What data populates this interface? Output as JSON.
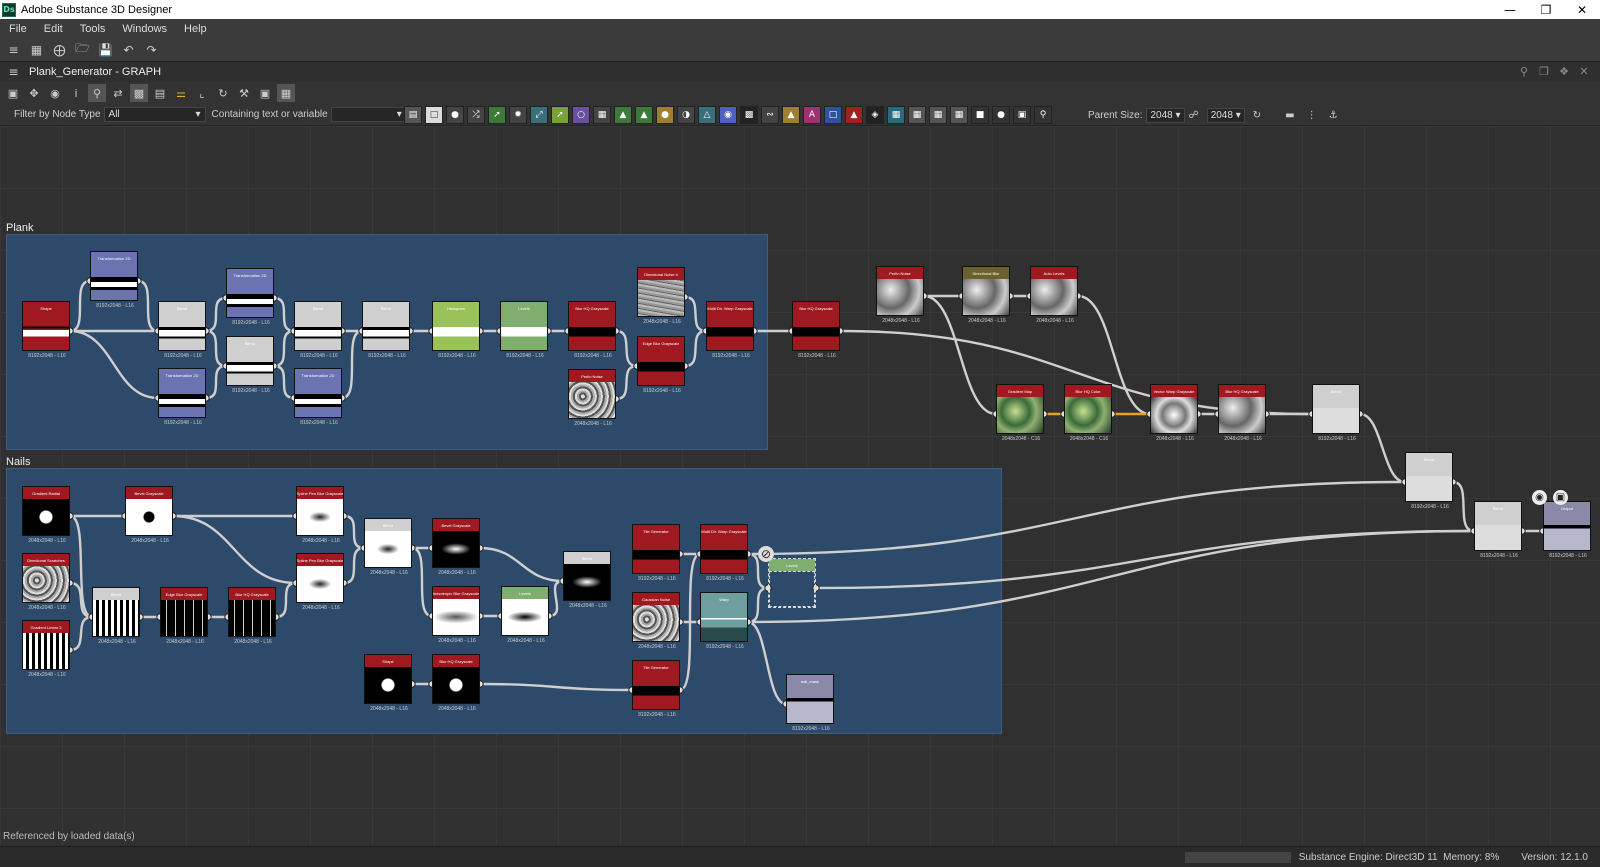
{
  "window": {
    "title": "Adobe Substance 3D Designer",
    "logo": "Ds"
  },
  "menu": [
    "File",
    "Edit",
    "Tools",
    "Windows",
    "Help"
  ],
  "graph": {
    "title": "Plank_Generator - GRAPH"
  },
  "filter": {
    "label_type": "Filter by Node Type",
    "type_value": "All",
    "label_text": "Containing text or variable",
    "text_value": ""
  },
  "parent_size": {
    "label": "Parent Size:",
    "width": "2048",
    "height": "2048"
  },
  "frames": {
    "plank": "Plank",
    "nails": "Nails"
  },
  "nodes": [
    {
      "id": "p1",
      "title": "Shape",
      "res": "8192x2048 - L16",
      "head": "#a01820",
      "body": "white-bar-red"
    },
    {
      "id": "p2",
      "title": "Transformation 2D",
      "res": "8192x2048 - L16",
      "head": "#6b73b0",
      "body": "bar-blue"
    },
    {
      "id": "p3",
      "title": "Blend",
      "res": "8192x2048 - L16",
      "head": "#cfcfcf",
      "body": "bar-gray"
    },
    {
      "id": "p4",
      "title": "Transformation 2D",
      "res": "8192x2048 - L16",
      "head": "#6b73b0",
      "body": "bar-blue"
    },
    {
      "id": "p5",
      "title": "Transformation 2D",
      "res": "8192x2048 - L16",
      "head": "#6b73b0",
      "body": "bar-blue"
    },
    {
      "id": "p6",
      "title": "Blend",
      "res": "8192x2048 - L16",
      "head": "#cfcfcf",
      "body": "bar-gray"
    },
    {
      "id": "p7",
      "title": "Blend",
      "res": "8192x2048 - L16",
      "head": "#cfcfcf",
      "body": "bar-gray"
    },
    {
      "id": "p8",
      "title": "Transformation 2D",
      "res": "8192x2048 - L16",
      "head": "#6b73b0",
      "body": "bar-blue"
    },
    {
      "id": "p9",
      "title": "Blend",
      "res": "8192x2048 - L16",
      "head": "#cfcfcf",
      "body": "bar-gray"
    },
    {
      "id": "p10",
      "title": "Histogram",
      "res": "8192x2048 - L16",
      "head": "#9ac25a",
      "body": "bar-green"
    },
    {
      "id": "p11",
      "title": "Levels",
      "res": "8192x2048 - L16",
      "head": "#7fae6e",
      "body": "bar-green2"
    },
    {
      "id": "p12",
      "title": "Blur HQ Grayscale",
      "res": "8192x2048 - L16",
      "head": "#a01820",
      "body": "red"
    },
    {
      "id": "p13",
      "title": "Perlin Noise",
      "res": "2048x2048 - L16",
      "head": "#a01820",
      "body": "noise"
    },
    {
      "id": "p14",
      "title": "Directional Noise 4",
      "res": "2048x2048 - L16",
      "head": "#a01820",
      "body": "noise2"
    },
    {
      "id": "p15",
      "title": "Edge Blur Grayscale",
      "res": "8192x2048 - L16",
      "head": "#a01820",
      "body": "red"
    },
    {
      "id": "p16",
      "title": "Multi Dir. Warp Grayscale",
      "res": "8192x2048 - L16",
      "head": "#a01820",
      "body": "red"
    },
    {
      "id": "p17",
      "title": "Blur HQ Grayscale",
      "res": "8192x2048 - L16",
      "head": "#a01820",
      "body": "red"
    },
    {
      "id": "w1",
      "title": "Perlin Noise",
      "res": "2048x2048 - L16",
      "head": "#a01820",
      "body": "blur"
    },
    {
      "id": "w2",
      "title": "Directional Blur",
      "res": "2048x2048 - L16",
      "head": "#6a6030",
      "body": "blur"
    },
    {
      "id": "w3",
      "title": "Auto Levels",
      "res": "2048x2048 - L16",
      "head": "#a01820",
      "body": "blur"
    },
    {
      "id": "w4",
      "title": "Gradient Map",
      "res": "2048x2048 - C16",
      "head": "#a01820",
      "body": "color"
    },
    {
      "id": "w5",
      "title": "Blur HQ Color",
      "res": "2048x2048 - C16",
      "head": "#a01820",
      "body": "color"
    },
    {
      "id": "w6",
      "title": "Vector Warp Grayscale",
      "res": "2048x2048 - L16",
      "head": "#a01820",
      "body": "warp"
    },
    {
      "id": "w7",
      "title": "Blur HQ Grayscale",
      "res": "2048x2048 - L16",
      "head": "#a01820",
      "body": "blur"
    },
    {
      "id": "w8",
      "title": "Blend",
      "res": "8192x2048 - L16",
      "head": "#cfcfcf",
      "body": "gray"
    },
    {
      "id": "w9",
      "title": "Blend",
      "res": "8192x2048 - L16",
      "head": "#cfcfcf",
      "body": "gray"
    },
    {
      "id": "w10",
      "title": "Blend",
      "res": "8192x2048 - L16",
      "head": "#cfcfcf",
      "body": "gray"
    },
    {
      "id": "w11",
      "title": "Output",
      "res": "8192x2048 - L16",
      "head": "#8a8aa8",
      "body": "out"
    },
    {
      "id": "n1",
      "title": "Gradient Radial",
      "res": "2048x2048 - L16",
      "head": "#a01820",
      "body": "dot-black"
    },
    {
      "id": "n2",
      "title": "Bevel Grayscale",
      "res": "2048x2048 - L16",
      "head": "#a01820",
      "body": "dot-white"
    },
    {
      "id": "n3",
      "title": "Directional Scratches",
      "res": "2048x2048 - L16",
      "head": "#a01820",
      "body": "noise"
    },
    {
      "id": "n4",
      "title": "Gradient Linear 3",
      "res": "2048x2048 - L16",
      "head": "#a01820",
      "body": "stripes"
    },
    {
      "id": "n5",
      "title": "Blend",
      "res": "2048x2048 - L16",
      "head": "#cfcfcf",
      "body": "stripes"
    },
    {
      "id": "n6",
      "title": "Edge Blur Grayscale",
      "res": "2048x2048 - L16",
      "head": "#a01820",
      "body": "dots"
    },
    {
      "id": "n7",
      "title": "Blur HQ Grayscale",
      "res": "2048x2048 - L16",
      "head": "#a01820",
      "body": "dots"
    },
    {
      "id": "n8",
      "title": "Spline Pen Blur Grayscale",
      "res": "2048x2048 - L16",
      "head": "#a01820",
      "body": "smudge"
    },
    {
      "id": "n9",
      "title": "Spline Pen Blur Grayscale",
      "res": "2048x2048 - L16",
      "head": "#a01820",
      "body": "smudge"
    },
    {
      "id": "n10",
      "title": "Blend",
      "res": "2048x2048 - L16",
      "head": "#cfcfcf",
      "body": "smudge"
    },
    {
      "id": "n11",
      "title": "Bevel Grayscale",
      "res": "2048x2048 - L16",
      "head": "#a01820",
      "body": "smudge-dark"
    },
    {
      "id": "n12",
      "title": "Anisotropic Blur Grayscale",
      "res": "2048x2048 - L16",
      "head": "#a01820",
      "body": "soft"
    },
    {
      "id": "n13",
      "title": "Levels",
      "res": "2048x2048 - L16",
      "head": "#7fae6e",
      "body": "soft-dark"
    },
    {
      "id": "n14",
      "title": "Blend",
      "res": "2048x2048 - L16",
      "head": "#cfcfcf",
      "body": "smudge-dark"
    },
    {
      "id": "n15",
      "title": "Shape",
      "res": "2048x2048 - L16",
      "head": "#a01820",
      "body": "dot-black"
    },
    {
      "id": "n16",
      "title": "Blur HQ Grayscale",
      "res": "2048x2048 - L16",
      "head": "#a01820",
      "body": "dot-black"
    },
    {
      "id": "n17",
      "title": "Tile Generator",
      "res": "8192x2048 - L16",
      "head": "#a01820",
      "body": "red"
    },
    {
      "id": "n18",
      "title": "Gaussian Noise",
      "res": "2048x2048 - L16",
      "head": "#a01820",
      "body": "noise"
    },
    {
      "id": "n19",
      "title": "Tile Generator",
      "res": "8192x2048 - L16",
      "head": "#a01820",
      "body": "red"
    },
    {
      "id": "n20",
      "title": "Multi Dir. Warp Grayscale",
      "res": "8192x2048 - L16",
      "head": "#a01820",
      "body": "red"
    },
    {
      "id": "n21",
      "title": "Warp",
      "res": "8192x2048 - L16",
      "head": "#6f9ea0",
      "body": "teal"
    },
    {
      "id": "n22",
      "title": "Levels",
      "res": "",
      "head": "#7fae6e",
      "body": "ghost"
    },
    {
      "id": "n23",
      "title": "nail_mask",
      "res": "8192x2048 - L16",
      "head": "#8a8aa8",
      "body": "out"
    }
  ],
  "status": {
    "left": "Referenced by loaded data(s)",
    "engine": "Substance Engine: Direct3D 11",
    "memory": "Memory: 8%",
    "version": "Version: 12.1.0"
  }
}
